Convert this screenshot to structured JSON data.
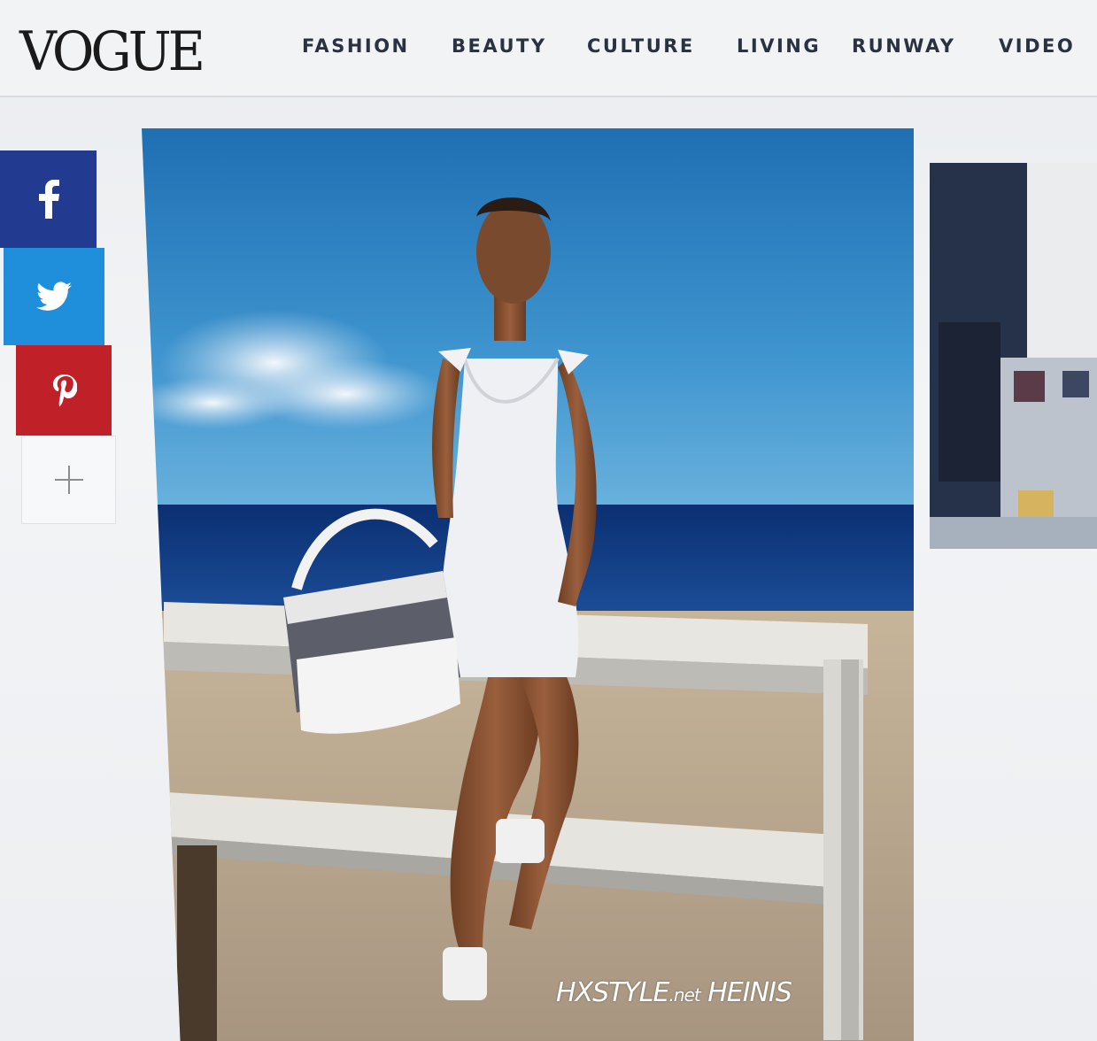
{
  "header": {
    "logo": "VOGUE",
    "nav": [
      {
        "label": "FASHION"
      },
      {
        "label": "BEAUTY"
      },
      {
        "label": "CULTURE"
      },
      {
        "label": "LIVING"
      },
      {
        "label": "RUNWAY"
      },
      {
        "label": "VIDEO"
      }
    ]
  },
  "share": {
    "facebook_icon": "facebook-icon",
    "twitter_icon": "twitter-icon",
    "pinterest_icon": "pinterest-icon",
    "more_icon": "plus-icon"
  },
  "watermark": {
    "part1": "HXSTYLE",
    "part2": ".net",
    "part3": " HEINIS"
  },
  "colors": {
    "facebook": "#223a8f",
    "twitter": "#1f8edb",
    "pinterest": "#c02128"
  }
}
